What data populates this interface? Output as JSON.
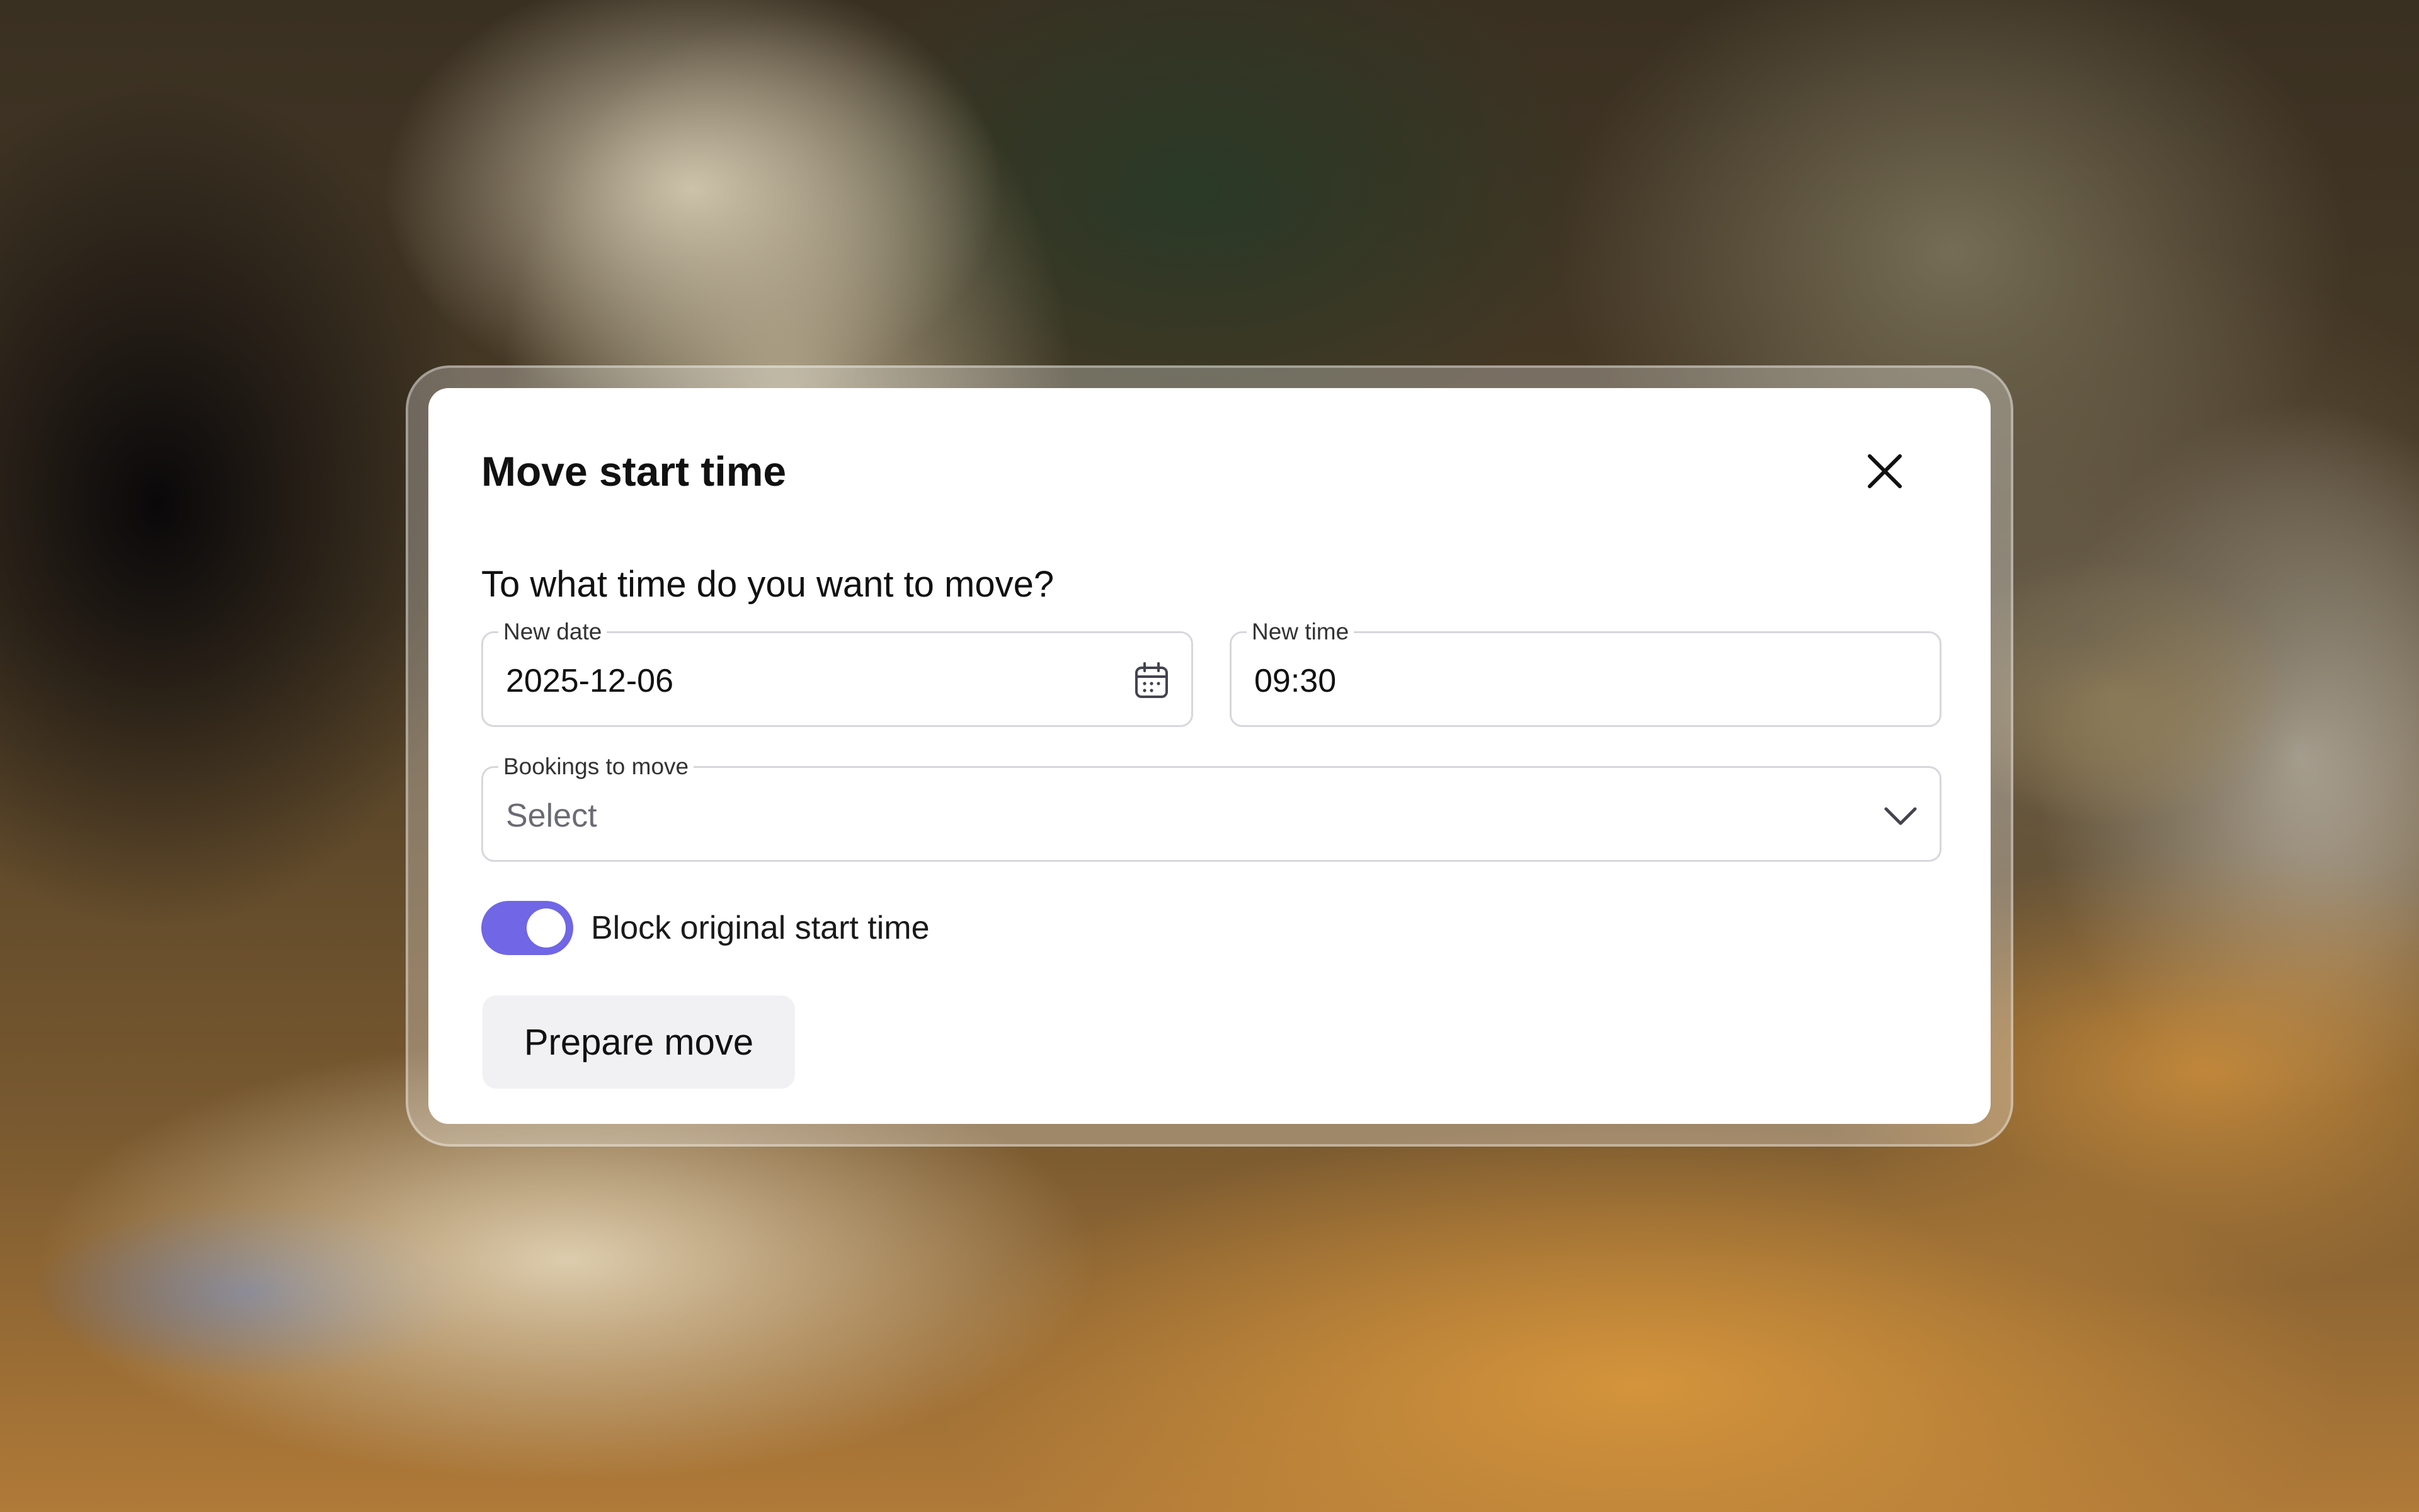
{
  "dialog": {
    "title": "Move start time",
    "question": "To what time do you want to move?",
    "date_field": {
      "label": "New date",
      "value": "2025-12-06",
      "icon": "calendar-icon"
    },
    "time_field": {
      "label": "New time",
      "value": "09:30"
    },
    "bookings_field": {
      "label": "Bookings to move",
      "placeholder": "Select",
      "icon": "chevron-down-icon"
    },
    "block_toggle": {
      "label": "Block original start time",
      "on": true
    },
    "submit_label": "Prepare move",
    "close_icon": "close-icon"
  },
  "colors": {
    "accent": "#7066e6",
    "button_bg": "#f1f0f3",
    "field_border": "#d7d7dc"
  }
}
